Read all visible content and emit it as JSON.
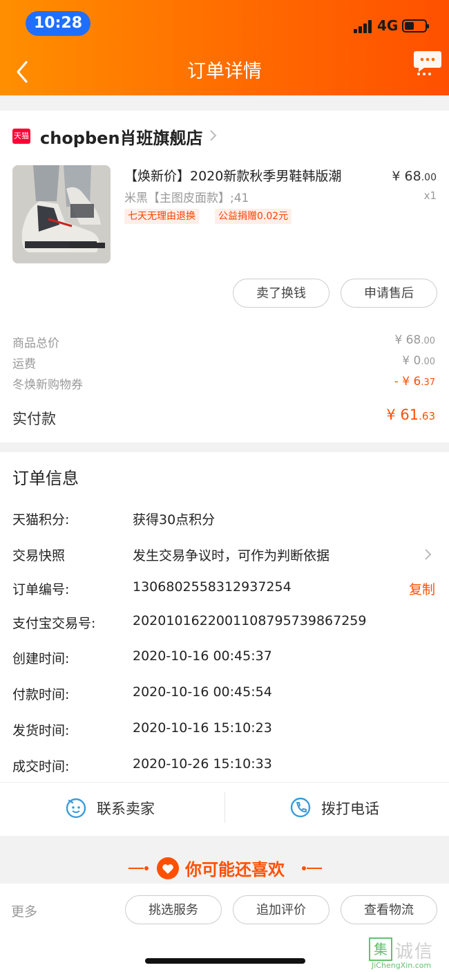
{
  "status_bar": {
    "time": "10:28",
    "network": "4G",
    "battery_level": 0.45
  },
  "nav": {
    "title": "订单详情"
  },
  "shop": {
    "name": "chopben肖班旗舰店",
    "badge": "天猫"
  },
  "product": {
    "title": "【焕新价】2020新款秋季男鞋韩版潮",
    "sku": "米黑【主图皮面款】;41",
    "tags": [
      "七天无理由退换",
      "公益捐赠0.02元"
    ],
    "price_main": "¥ 68",
    "price_cents": ".00",
    "qty": "x1"
  },
  "actions": {
    "sell": "卖了换钱",
    "after_sale": "申请售后"
  },
  "summary": [
    {
      "label": "商品总价",
      "value_main": "¥ 68",
      "value_cents": ".00"
    },
    {
      "label": "运费",
      "value_main": "¥ 0",
      "value_cents": ".00"
    },
    {
      "label": "冬焕新购物券",
      "value_main": "- ¥ 6",
      "value_cents": ".37"
    }
  ],
  "paid": {
    "label": "实付款",
    "value_main": "¥ 61",
    "value_cents": ".63"
  },
  "order_info": {
    "title": "订单信息",
    "rows": [
      {
        "label": "天猫积分:",
        "value": "获得30点积分"
      },
      {
        "label": "交易快照",
        "value": "发生交易争议时，可作为判断依据"
      },
      {
        "label": "订单编号:",
        "value": "1306802558312937254"
      },
      {
        "label": "支付宝交易号:",
        "value": "2020101622001108795739867259"
      },
      {
        "label": "创建时间:",
        "value": "2020-10-16 00:45:37"
      },
      {
        "label": "付款时间:",
        "value": "2020-10-16 00:45:54"
      },
      {
        "label": "发货时间:",
        "value": "2020-10-16 15:10:23"
      },
      {
        "label": "成交时间:",
        "value": "2020-10-26 15:10:33"
      }
    ],
    "copy_label": "复制"
  },
  "contact": {
    "seller": "联系卖家",
    "phone": "拨打电话"
  },
  "recommend": {
    "title": "你可能还喜欢"
  },
  "bottom": {
    "more": "更多",
    "pick_service": "挑选服务",
    "add_review": "追加评价",
    "view_logistics": "查看物流"
  },
  "watermark": {
    "text": "集诚信",
    "sub": "JiChengXin.com"
  },
  "colors": {
    "accent": "#ff5000",
    "header_start": "#ff8f00",
    "tag_text": "#ff4000"
  }
}
